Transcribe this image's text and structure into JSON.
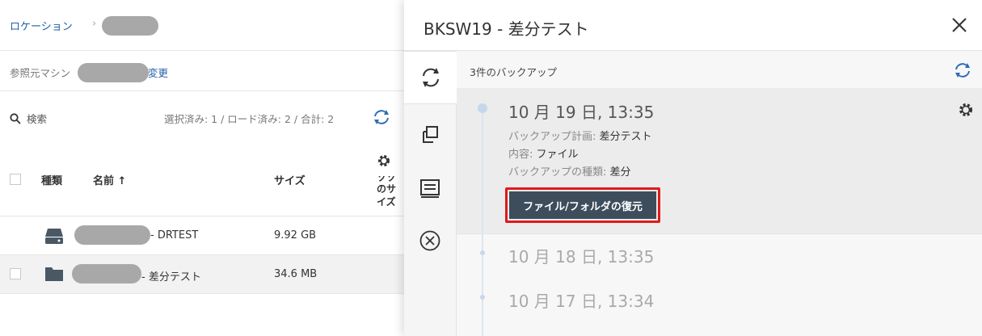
{
  "left": {
    "breadcrumb_root": "ロケーション",
    "breadcrumb_sep": "›",
    "source_machine_label": "参照元マシン",
    "change_link": "変更",
    "search_label": "検索",
    "selection_counts": "選択済み: 1 / ロード済み: 2 / 合計: 2",
    "columns": {
      "type": "種類",
      "name": "名前 ↑",
      "size": "サイズ",
      "extra_line1": "ソソ",
      "extra_line2": "のサ",
      "extra_line3": "イズ"
    },
    "rows": [
      {
        "name_suffix": "- DRTEST",
        "size": "9.92 GB",
        "icon": "drive-icon"
      },
      {
        "name_suffix": "- 差分テスト",
        "size": "34.6 MB",
        "icon": "folder-icon"
      }
    ]
  },
  "panel": {
    "title": "BKSW19 - 差分テスト",
    "backup_count": "3件のバックアップ",
    "tabs": [
      "recovery-icon",
      "copy-icon",
      "details-icon",
      "delete-icon"
    ],
    "backups": [
      {
        "date": "10 月 19 日, 13:35",
        "plan_label": "バックアップ計画: ",
        "plan_value": "差分テスト",
        "content_label": "内容: ",
        "content_value": "ファイル",
        "type_label": "バックアップの種類: ",
        "type_value": "差分",
        "restore_button": "ファイル/フォルダの復元"
      },
      {
        "date": "10 月 18 日, 13:35"
      },
      {
        "date": "10 月 17 日, 13:34"
      }
    ],
    "colors": {
      "accent": "#1f5fa8",
      "button": "#3e4d5c",
      "highlight": "#e01a1a"
    }
  }
}
